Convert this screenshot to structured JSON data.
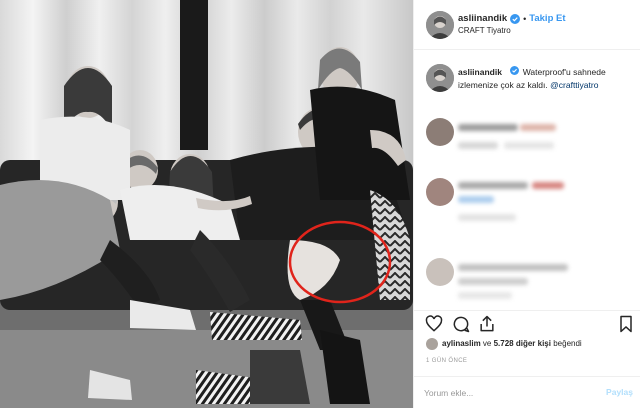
{
  "post": {
    "username": "asliinandik",
    "follow_label": "Takip Et",
    "dot": "•",
    "location": "CRAFT Tiyatro"
  },
  "caption": {
    "username": "asliinandik",
    "text": "Waterproof'u sahnede izlemenize çok az kaldı.",
    "mention": "@crafttiyatro"
  },
  "likes": {
    "liker": "aylinaslim",
    "connector": "ve",
    "count_text": "5.728 diğer kişi",
    "suffix": "beğendi"
  },
  "time_label": "1 GÜN ÖNCE",
  "comment_box": {
    "placeholder": "Yorum ekle...",
    "share_label": "Paylaş"
  },
  "icons": [
    "verified-badge-icon",
    "heart-icon",
    "comment-icon",
    "share-icon",
    "bookmark-icon"
  ],
  "colors": {
    "accent": "#3897f0",
    "verified": "#3897f0",
    "highlight_circle": "#e0241b",
    "border": "#efefef"
  }
}
